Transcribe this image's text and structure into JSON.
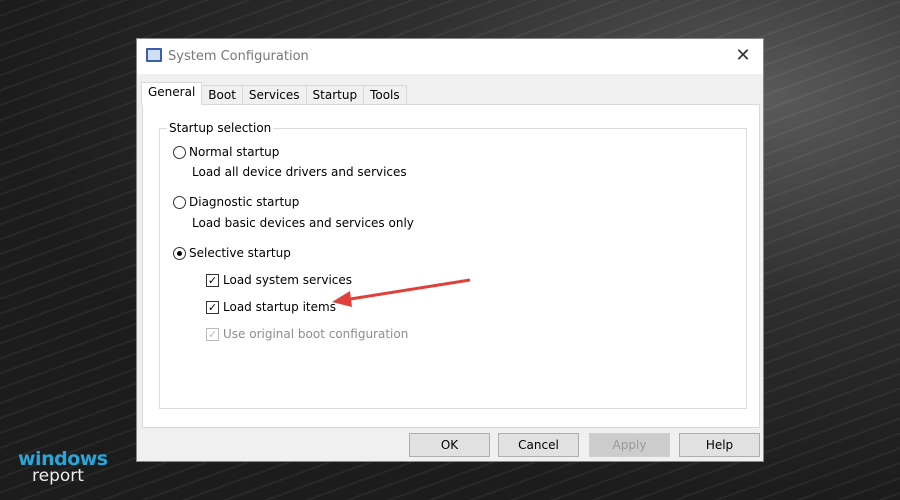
{
  "window": {
    "title": "System Configuration",
    "close_icon": "close-icon"
  },
  "tabs": [
    {
      "label": "General",
      "active": true
    },
    {
      "label": "Boot"
    },
    {
      "label": "Services"
    },
    {
      "label": "Startup"
    },
    {
      "label": "Tools"
    }
  ],
  "group": {
    "legend": "Startup selection",
    "normal": {
      "label": "Normal startup",
      "desc": "Load all device drivers and services",
      "selected": false
    },
    "diagnostic": {
      "label": "Diagnostic startup",
      "desc": "Load basic devices and services only",
      "selected": false
    },
    "selective": {
      "label": "Selective startup",
      "selected": true
    },
    "load_system": {
      "label": "Load system services",
      "checked": true
    },
    "load_startup": {
      "label": "Load startup items",
      "checked": true
    },
    "use_original": {
      "label": "Use original boot configuration",
      "checked": true,
      "disabled": true
    }
  },
  "buttons": {
    "ok": "OK",
    "cancel": "Cancel",
    "apply": "Apply",
    "help": "Help"
  },
  "logo": {
    "line1": "windows",
    "line2": "report"
  },
  "colors": {
    "arrow": "#e0403a",
    "logo_blue": "#2aa5d8"
  }
}
